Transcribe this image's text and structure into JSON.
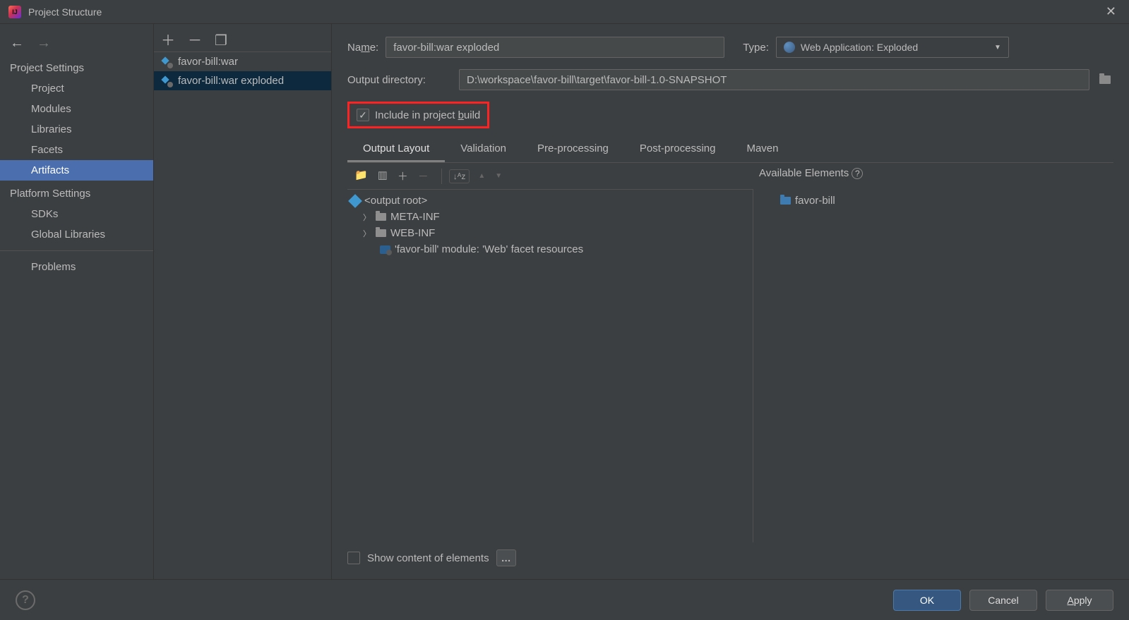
{
  "title": "Project Structure",
  "sidebar": {
    "section1": "Project Settings",
    "items1": [
      "Project",
      "Modules",
      "Libraries",
      "Facets",
      "Artifacts"
    ],
    "section2": "Platform Settings",
    "items2": [
      "SDKs",
      "Global Libraries"
    ],
    "problems": "Problems"
  },
  "artifacts_list": [
    {
      "label": "favor-bill:war"
    },
    {
      "label": "favor-bill:war exploded"
    }
  ],
  "detail": {
    "name_label": "Name:",
    "name_value": "favor-bill:war exploded",
    "type_label": "Type:",
    "type_value": "Web Application: Exploded",
    "out_dir_label": "Output directory:",
    "out_dir_value": "D:\\workspace\\favor-bill\\target\\favor-bill-1.0-SNAPSHOT",
    "include_label": "Include in project build",
    "tabs": [
      "Output Layout",
      "Validation",
      "Pre-processing",
      "Post-processing",
      "Maven"
    ],
    "available_label": "Available Elements",
    "tree": {
      "root": "<output root>",
      "meta_inf": "META-INF",
      "web_inf": "WEB-INF",
      "facet": "'favor-bill' module: 'Web' facet resources"
    },
    "avail_item": "favor-bill",
    "show_content": "Show content of elements"
  },
  "footer": {
    "ok": "OK",
    "cancel": "Cancel",
    "apply": "Apply"
  }
}
